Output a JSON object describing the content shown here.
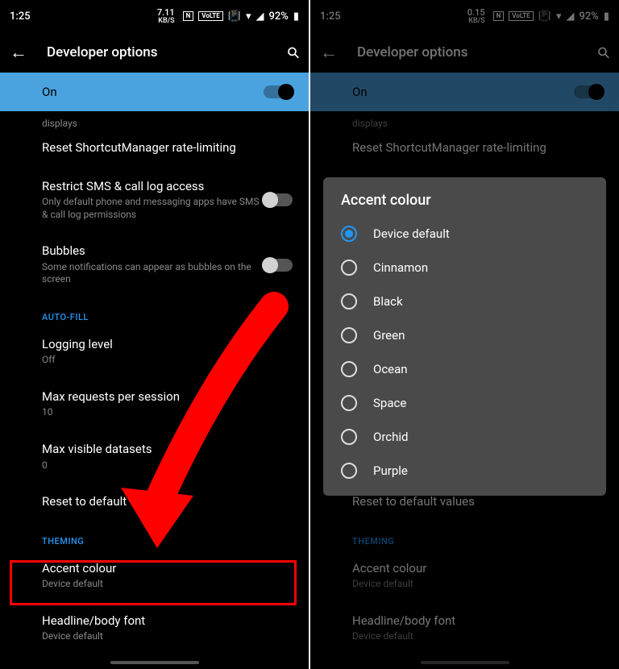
{
  "statusbar": {
    "time": "1:25",
    "net1": "7.11",
    "net1_unit": "KB/S",
    "net2": "0.15",
    "net2_unit": "KB/S",
    "nfc": "N",
    "volte": "VoLTE",
    "battery": "92%"
  },
  "header": {
    "title": "Developer options"
  },
  "on_strip": {
    "label": "On"
  },
  "rows": {
    "displays_trail": "displays",
    "reset_shortcut": "Reset ShortcutManager rate-limiting",
    "restrict_sms": "Restrict SMS & call log access",
    "restrict_sms_sub": "Only default phone and messaging apps have SMS & call log permissions",
    "bubbles": "Bubbles",
    "bubbles_sub": "Some notifications can appear as bubbles on the screen",
    "autofill": "AUTO-FILL",
    "logging": "Logging level",
    "logging_sub": "Off",
    "max_req": "Max requests per session",
    "max_req_sub": "10",
    "max_vis": "Max visible datasets",
    "max_vis_sub": "0",
    "reset_default_full": "Reset to default values",
    "reset_default_trunc": "Reset to default",
    "theming": "THEMING",
    "accent": "Accent colour",
    "accent_sub": "Device default",
    "headline": "Headline/body font",
    "headline_sub": "Device default"
  },
  "dialog": {
    "title": "Accent colour",
    "options": {
      "o0": "Device default",
      "o1": "Cinnamon",
      "o2": "Black",
      "o3": "Green",
      "o4": "Ocean",
      "o5": "Space",
      "o6": "Orchid",
      "o7": "Purple"
    }
  }
}
